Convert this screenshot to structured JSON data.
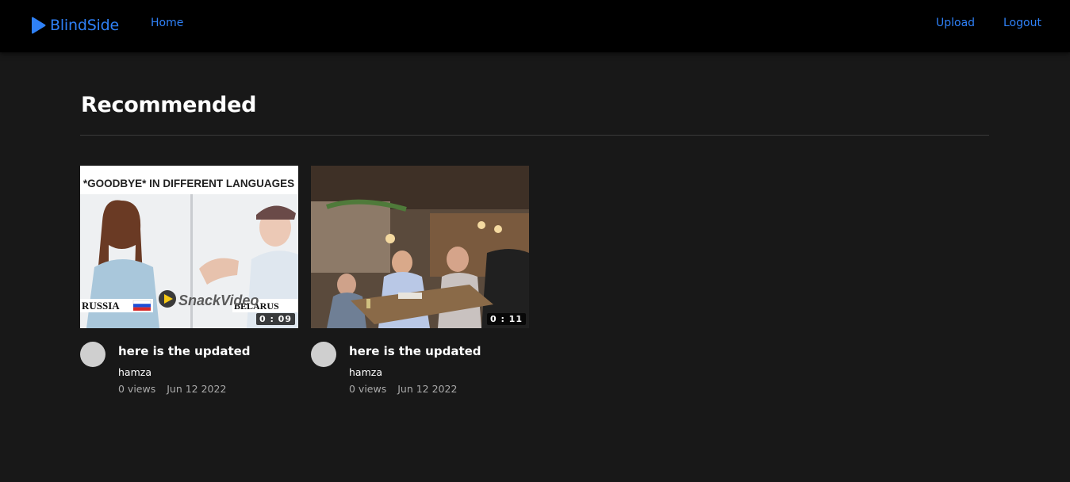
{
  "header": {
    "brand": "BlindSide",
    "brand_color": "#2f81f7",
    "nav": {
      "home": "Home",
      "upload": "Upload",
      "logout": "Logout"
    }
  },
  "main": {
    "section_title": "Recommended",
    "videos": [
      {
        "thumbnail_text": "*GOODBYE* IN DIFFERENT LANGUAGES",
        "thumbnail_label_left": "RUSSIA",
        "thumbnail_label_right": "BELARUS",
        "thumbnail_watermark": "SnackVideo",
        "duration": "0 : 09",
        "title": "here is the updated",
        "channel": "hamza",
        "views": "0 views",
        "date": "Jun 12 2022"
      },
      {
        "duration": "0 : 11",
        "title": "here is the updated",
        "channel": "hamza",
        "views": "0 views",
        "date": "Jun 12 2022"
      }
    ]
  }
}
